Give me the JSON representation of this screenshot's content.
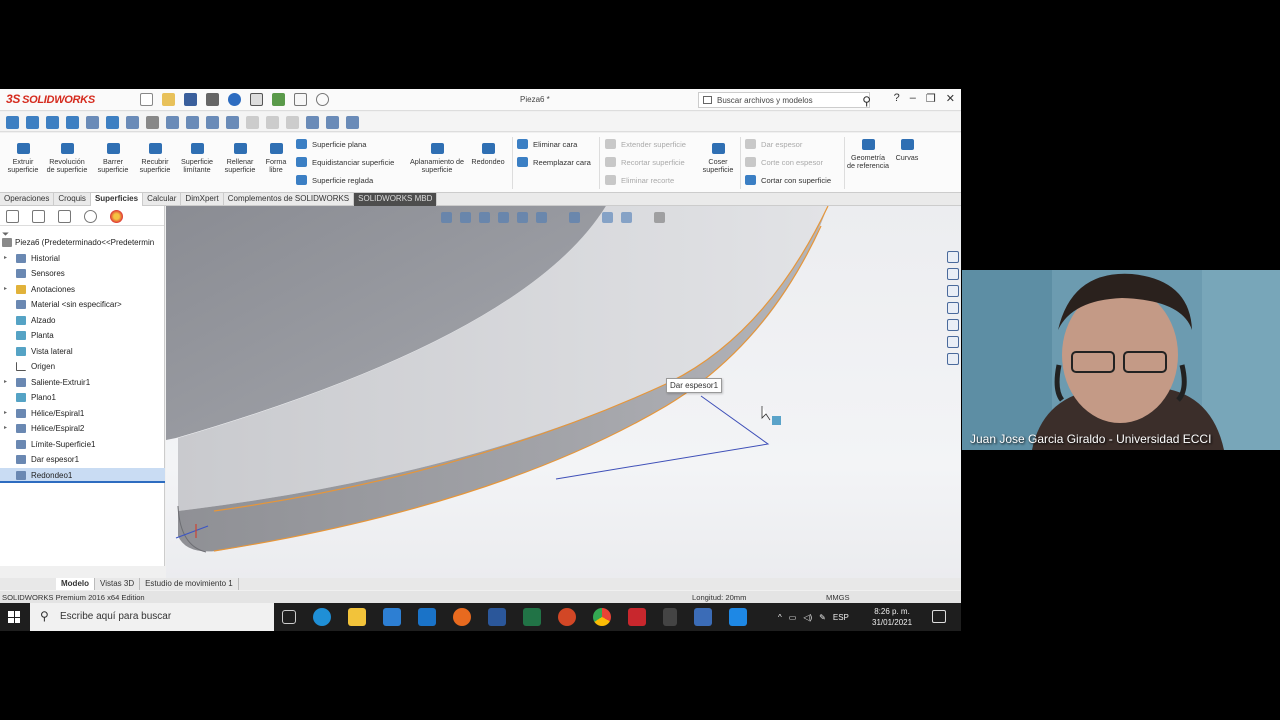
{
  "app": {
    "logo": "SOLIDWORKS",
    "logo_ds": "3S",
    "document_title": "Pieza6 *",
    "search_placeholder": "Buscar archivos y modelos",
    "help": "?"
  },
  "ribbon": {
    "buttons": [
      {
        "label": "Extruir superficie"
      },
      {
        "label": "Revolución de superficie"
      },
      {
        "label": "Barrer superficie"
      },
      {
        "label": "Recubrir superficie"
      },
      {
        "label": "Superficie limítante"
      },
      {
        "label": "Rellenar superficie"
      },
      {
        "label": "Forma libre"
      }
    ],
    "group1": [
      "Superficie plana",
      "Equidistanciar superficie",
      "Superficie reglada"
    ],
    "aplanamiento": "Aplanamiento de superficie",
    "redondeo": "Redondeo",
    "group2": [
      "Eliminar cara",
      "Reemplazar cara"
    ],
    "group3_disabled": [
      "Extender superficie",
      "Recortar superficie",
      "Eliminar recorte"
    ],
    "coser": "Coser superficie",
    "group4": [
      {
        "label": "Dar espesor",
        "disabled": true
      },
      {
        "label": "Corte con espesor",
        "disabled": true
      },
      {
        "label": "Cortar con superficie",
        "disabled": false
      }
    ],
    "geometria": "Geometría de referencia",
    "curvas": "Curvas"
  },
  "tabs": [
    {
      "label": "Operaciones",
      "state": "normal"
    },
    {
      "label": "Croquis",
      "state": "normal"
    },
    {
      "label": "Superficies",
      "state": "active"
    },
    {
      "label": "Calcular",
      "state": "normal"
    },
    {
      "label": "DimXpert",
      "state": "normal"
    },
    {
      "label": "Complementos de SOLIDWORKS",
      "state": "normal"
    },
    {
      "label": "SOLIDWORKS MBD",
      "state": "dark"
    }
  ],
  "tree": {
    "root": "Pieza6  (Predeterminado<<Predetermin",
    "items": [
      {
        "label": "Historial",
        "arrow": true
      },
      {
        "label": "Sensores",
        "arrow": false
      },
      {
        "label": "Anotaciones",
        "arrow": true
      },
      {
        "label": "Material <sin especificar>",
        "arrow": false
      },
      {
        "label": "Alzado",
        "arrow": false
      },
      {
        "label": "Planta",
        "arrow": false
      },
      {
        "label": "Vista lateral",
        "arrow": false
      },
      {
        "label": "Origen",
        "arrow": false
      },
      {
        "label": "Saliente-Extruir1",
        "arrow": true
      },
      {
        "label": "Plano1",
        "arrow": false
      },
      {
        "label": "Hélice/Espiral1",
        "arrow": true
      },
      {
        "label": "Hélice/Espiral2",
        "arrow": true
      },
      {
        "label": "Límite-Superficie1",
        "arrow": false
      },
      {
        "label": "Dar espesor1",
        "arrow": false
      },
      {
        "label": "Redondeo1",
        "arrow": false,
        "selected": true
      }
    ]
  },
  "viewport": {
    "tooltip": "Dar espesor1"
  },
  "bottom_tabs": [
    "Modelo",
    "Vistas 3D",
    "Estudio de movimiento 1"
  ],
  "status": {
    "edition": "SOLIDWORKS Premium 2016 x64 Edition",
    "length": "Longitud: 20mm",
    "units": "MMGS"
  },
  "taskbar": {
    "search": "Escribe aquí para buscar",
    "lang": "ESP",
    "time": "8:26 p. m.",
    "date": "31/01/2021",
    "notifications": "4"
  },
  "webcam": {
    "name": "Juan Jose Garcia Giraldo - Universidad ECCI"
  }
}
